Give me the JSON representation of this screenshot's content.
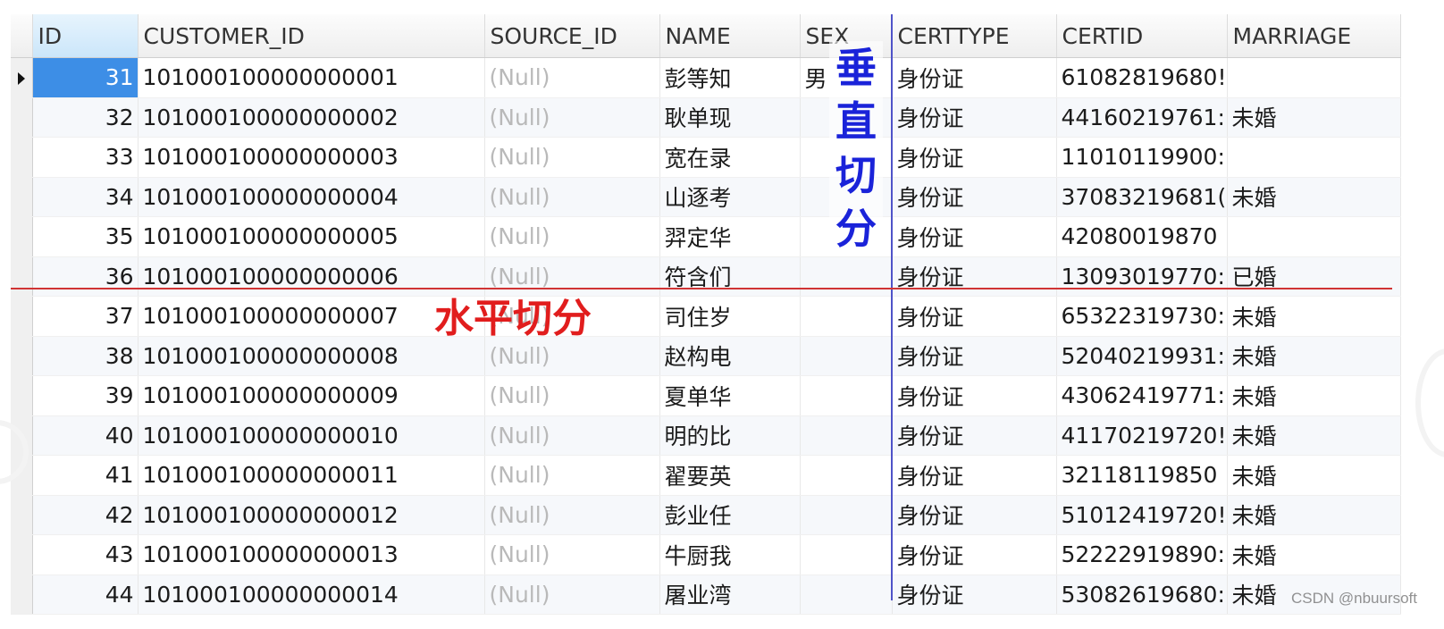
{
  "columns": [
    "ID",
    "CUSTOMER_ID",
    "SOURCE_ID",
    "NAME",
    "SEX",
    "CERTTYPE",
    "CERTID",
    "MARRIAGE"
  ],
  "rows": [
    {
      "id": "31",
      "customer_id": "101000100000000001",
      "source_id": "(Null)",
      "name": "彭等知",
      "sex": "男",
      "certtype": "身份证",
      "certid": "61082819680!",
      "marriage": ""
    },
    {
      "id": "32",
      "customer_id": "101000100000000002",
      "source_id": "(Null)",
      "name": "耿单现",
      "sex": "",
      "certtype": "身份证",
      "certid": "44160219761:",
      "marriage": "未婚"
    },
    {
      "id": "33",
      "customer_id": "101000100000000003",
      "source_id": "(Null)",
      "name": "宽在录",
      "sex": "",
      "certtype": "身份证",
      "certid": "11010119900:",
      "marriage": ""
    },
    {
      "id": "34",
      "customer_id": "101000100000000004",
      "source_id": "(Null)",
      "name": "山逐考",
      "sex": "",
      "certtype": "身份证",
      "certid": "37083219681(",
      "marriage": "未婚"
    },
    {
      "id": "35",
      "customer_id": "101000100000000005",
      "source_id": "(Null)",
      "name": "羿定华",
      "sex": "",
      "certtype": "身份证",
      "certid": "42080019870",
      "marriage": ""
    },
    {
      "id": "36",
      "customer_id": "101000100000000006",
      "source_id": "(Null)",
      "name": "符含们",
      "sex": "",
      "certtype": "身份证",
      "certid": "13093019770:",
      "marriage": "已婚"
    },
    {
      "id": "37",
      "customer_id": "101000100000000007",
      "source_id": "(Null)",
      "name": "司住岁",
      "sex": "",
      "certtype": "身份证",
      "certid": "65322319730:",
      "marriage": "未婚"
    },
    {
      "id": "38",
      "customer_id": "101000100000000008",
      "source_id": "(Null)",
      "name": "赵构电",
      "sex": "",
      "certtype": "身份证",
      "certid": "52040219931:",
      "marriage": "未婚"
    },
    {
      "id": "39",
      "customer_id": "101000100000000009",
      "source_id": "(Null)",
      "name": "夏单华",
      "sex": "",
      "certtype": "身份证",
      "certid": "43062419771:",
      "marriage": "未婚"
    },
    {
      "id": "40",
      "customer_id": "101000100000000010",
      "source_id": "(Null)",
      "name": "明的比",
      "sex": "",
      "certtype": "身份证",
      "certid": "41170219720!",
      "marriage": "未婚"
    },
    {
      "id": "41",
      "customer_id": "101000100000000011",
      "source_id": "(Null)",
      "name": "翟要英",
      "sex": "",
      "certtype": "身份证",
      "certid": "32118119850",
      "marriage": "未婚"
    },
    {
      "id": "42",
      "customer_id": "101000100000000012",
      "source_id": "(Null)",
      "name": "彭业任",
      "sex": "",
      "certtype": "身份证",
      "certid": "51012419720!",
      "marriage": "未婚"
    },
    {
      "id": "43",
      "customer_id": "101000100000000013",
      "source_id": "(Null)",
      "name": "牛厨我",
      "sex": "",
      "certtype": "身份证",
      "certid": "52222919890:",
      "marriage": "未婚"
    },
    {
      "id": "44",
      "customer_id": "101000100000000014",
      "source_id": "(Null)",
      "name": "屠业湾",
      "sex": "",
      "certtype": "身份证",
      "certid": "53082619680:",
      "marriage": "未婚"
    }
  ],
  "annotations": {
    "vertical_chars": [
      "垂",
      "直",
      "切",
      "分"
    ],
    "horizontal": "水平切分",
    "vertical_color": "#1a23d9",
    "horizontal_color": "#e11d1d"
  },
  "selected_row_id": "31",
  "selection_color": "#3d8ee6",
  "watermark": "CSDN @nbuursoft"
}
